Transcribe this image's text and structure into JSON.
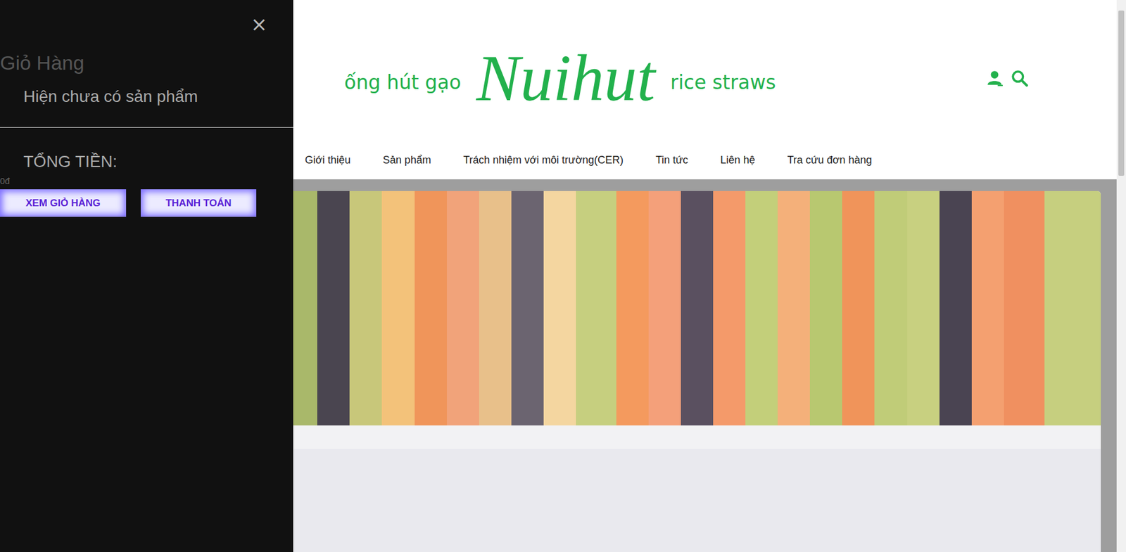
{
  "cart": {
    "close": "×",
    "title": "Giỏ Hàng",
    "empty_message": "Hiện chưa có sản phẩm",
    "total_label": "TỔNG TIỀN:",
    "total_value": "0đ",
    "buttons": [
      "XEM GIỎ HÀNG",
      "THANH TOÁN"
    ]
  },
  "header": {
    "logo": {
      "left": "ống hút gạo",
      "brand": "Nuihut",
      "right": "rice straws"
    }
  },
  "nav": [
    "Giới thiệu",
    "Sản phẩm",
    "Trách nhiệm với môi trường(CER)",
    "Tin tức",
    "Liên hệ",
    "Tra cứu đơn hàng"
  ]
}
